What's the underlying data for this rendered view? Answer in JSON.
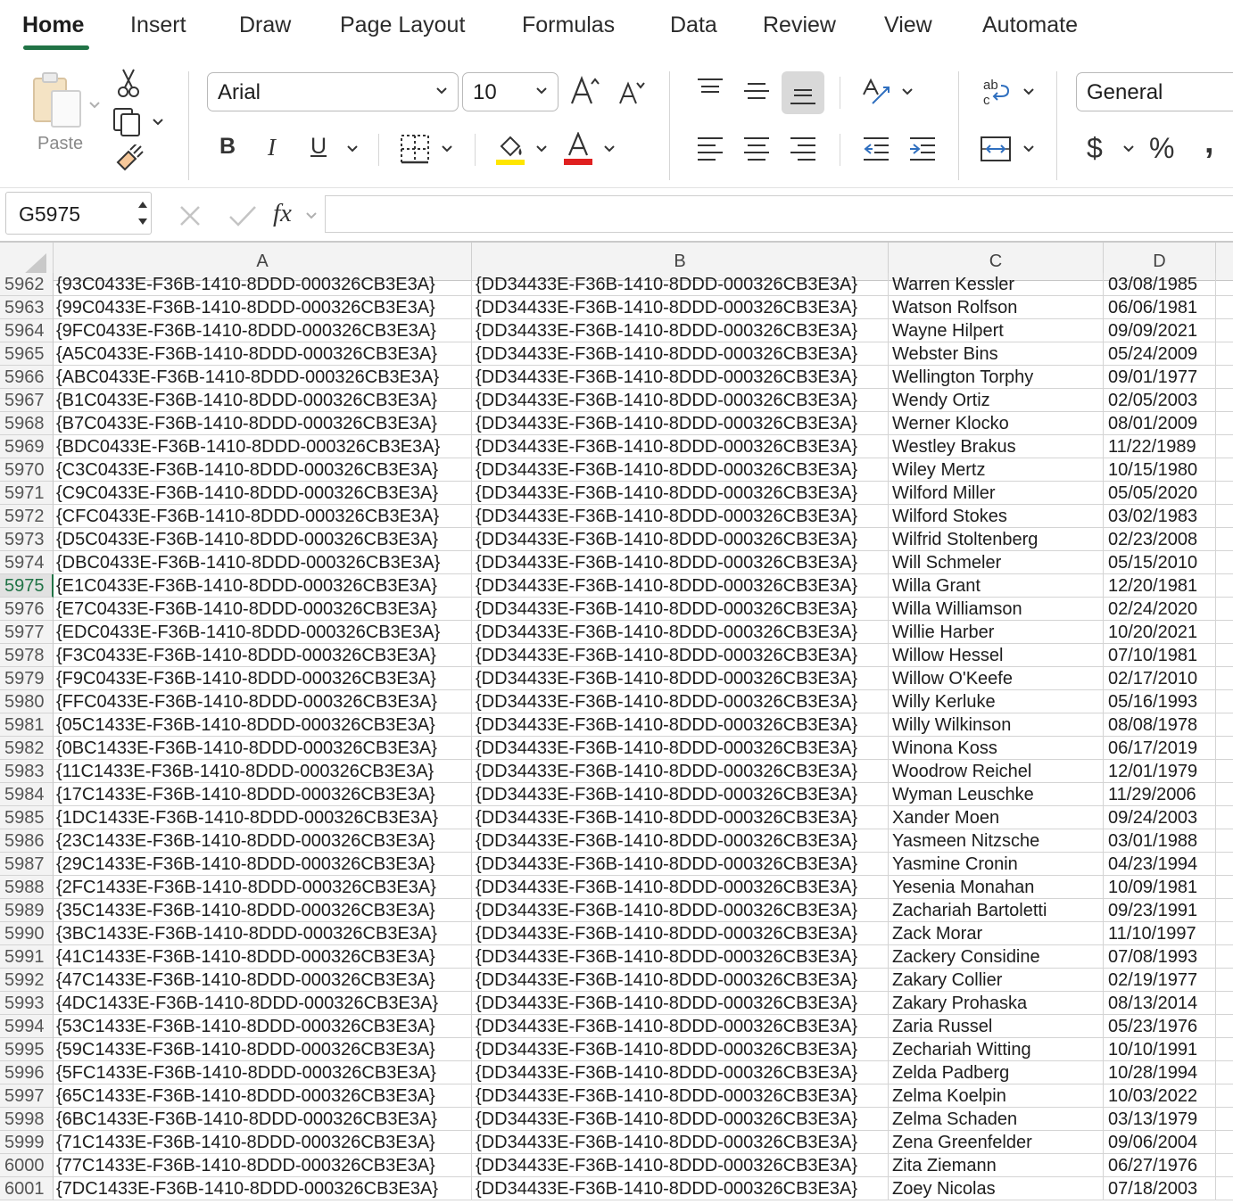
{
  "tabs": [
    "Home",
    "Insert",
    "Draw",
    "Page Layout",
    "Formulas",
    "Data",
    "Review",
    "View",
    "Automate"
  ],
  "clipboard": {
    "paste_label": "Paste"
  },
  "font": {
    "name": "Arial",
    "size": "10",
    "bold": "B",
    "italic": "I",
    "underline": "U"
  },
  "number": {
    "format": "General",
    "currency": "$",
    "percent": "%",
    "comma": "‚"
  },
  "formula_bar": {
    "name_box": "G5975",
    "fx": "fx",
    "value": ""
  },
  "colors": {
    "accent": "#217346",
    "fill": "#ffe600",
    "font_color": "#e02020"
  },
  "columns": [
    "A",
    "B",
    "C",
    "D"
  ],
  "selected_row": "5975",
  "rows": [
    {
      "n": "5962",
      "a": "{93C0433E-F36B-1410-8DDD-000326CB3E3A}",
      "b": "{DD34433E-F36B-1410-8DDD-000326CB3E3A}",
      "c": "Warren Kessler",
      "d": "03/08/1985"
    },
    {
      "n": "5963",
      "a": "{99C0433E-F36B-1410-8DDD-000326CB3E3A}",
      "b": "{DD34433E-F36B-1410-8DDD-000326CB3E3A}",
      "c": "Watson Rolfson",
      "d": "06/06/1981"
    },
    {
      "n": "5964",
      "a": "{9FC0433E-F36B-1410-8DDD-000326CB3E3A}",
      "b": "{DD34433E-F36B-1410-8DDD-000326CB3E3A}",
      "c": "Wayne Hilpert",
      "d": "09/09/2021"
    },
    {
      "n": "5965",
      "a": "{A5C0433E-F36B-1410-8DDD-000326CB3E3A}",
      "b": "{DD34433E-F36B-1410-8DDD-000326CB3E3A}",
      "c": "Webster Bins",
      "d": "05/24/2009"
    },
    {
      "n": "5966",
      "a": "{ABC0433E-F36B-1410-8DDD-000326CB3E3A}",
      "b": "{DD34433E-F36B-1410-8DDD-000326CB3E3A}",
      "c": "Wellington Torphy",
      "d": "09/01/1977"
    },
    {
      "n": "5967",
      "a": "{B1C0433E-F36B-1410-8DDD-000326CB3E3A}",
      "b": "{DD34433E-F36B-1410-8DDD-000326CB3E3A}",
      "c": "Wendy Ortiz",
      "d": "02/05/2003"
    },
    {
      "n": "5968",
      "a": "{B7C0433E-F36B-1410-8DDD-000326CB3E3A}",
      "b": "{DD34433E-F36B-1410-8DDD-000326CB3E3A}",
      "c": "Werner Klocko",
      "d": "08/01/2009"
    },
    {
      "n": "5969",
      "a": "{BDC0433E-F36B-1410-8DDD-000326CB3E3A}",
      "b": "{DD34433E-F36B-1410-8DDD-000326CB3E3A}",
      "c": "Westley Brakus",
      "d": "11/22/1989"
    },
    {
      "n": "5970",
      "a": "{C3C0433E-F36B-1410-8DDD-000326CB3E3A}",
      "b": "{DD34433E-F36B-1410-8DDD-000326CB3E3A}",
      "c": "Wiley Mertz",
      "d": "10/15/1980"
    },
    {
      "n": "5971",
      "a": "{C9C0433E-F36B-1410-8DDD-000326CB3E3A}",
      "b": "{DD34433E-F36B-1410-8DDD-000326CB3E3A}",
      "c": "Wilford Miller",
      "d": "05/05/2020"
    },
    {
      "n": "5972",
      "a": "{CFC0433E-F36B-1410-8DDD-000326CB3E3A}",
      "b": "{DD34433E-F36B-1410-8DDD-000326CB3E3A}",
      "c": "Wilford Stokes",
      "d": "03/02/1983"
    },
    {
      "n": "5973",
      "a": "{D5C0433E-F36B-1410-8DDD-000326CB3E3A}",
      "b": "{DD34433E-F36B-1410-8DDD-000326CB3E3A}",
      "c": "Wilfrid Stoltenberg",
      "d": "02/23/2008"
    },
    {
      "n": "5974",
      "a": "{DBC0433E-F36B-1410-8DDD-000326CB3E3A}",
      "b": "{DD34433E-F36B-1410-8DDD-000326CB3E3A}",
      "c": "Will Schmeler",
      "d": "05/15/2010"
    },
    {
      "n": "5975",
      "a": "{E1C0433E-F36B-1410-8DDD-000326CB3E3A}",
      "b": "{DD34433E-F36B-1410-8DDD-000326CB3E3A}",
      "c": "Willa Grant",
      "d": "12/20/1981"
    },
    {
      "n": "5976",
      "a": "{E7C0433E-F36B-1410-8DDD-000326CB3E3A}",
      "b": "{DD34433E-F36B-1410-8DDD-000326CB3E3A}",
      "c": "Willa Williamson",
      "d": "02/24/2020"
    },
    {
      "n": "5977",
      "a": "{EDC0433E-F36B-1410-8DDD-000326CB3E3A}",
      "b": "{DD34433E-F36B-1410-8DDD-000326CB3E3A}",
      "c": "Willie Harber",
      "d": "10/20/2021"
    },
    {
      "n": "5978",
      "a": "{F3C0433E-F36B-1410-8DDD-000326CB3E3A}",
      "b": "{DD34433E-F36B-1410-8DDD-000326CB3E3A}",
      "c": "Willow Hessel",
      "d": "07/10/1981"
    },
    {
      "n": "5979",
      "a": "{F9C0433E-F36B-1410-8DDD-000326CB3E3A}",
      "b": "{DD34433E-F36B-1410-8DDD-000326CB3E3A}",
      "c": "Willow O'Keefe",
      "d": "02/17/2010"
    },
    {
      "n": "5980",
      "a": "{FFC0433E-F36B-1410-8DDD-000326CB3E3A}",
      "b": "{DD34433E-F36B-1410-8DDD-000326CB3E3A}",
      "c": "Willy Kerluke",
      "d": "05/16/1993"
    },
    {
      "n": "5981",
      "a": "{05C1433E-F36B-1410-8DDD-000326CB3E3A}",
      "b": "{DD34433E-F36B-1410-8DDD-000326CB3E3A}",
      "c": "Willy Wilkinson",
      "d": "08/08/1978"
    },
    {
      "n": "5982",
      "a": "{0BC1433E-F36B-1410-8DDD-000326CB3E3A}",
      "b": "{DD34433E-F36B-1410-8DDD-000326CB3E3A}",
      "c": "Winona Koss",
      "d": "06/17/2019"
    },
    {
      "n": "5983",
      "a": "{11C1433E-F36B-1410-8DDD-000326CB3E3A}",
      "b": "{DD34433E-F36B-1410-8DDD-000326CB3E3A}",
      "c": "Woodrow Reichel",
      "d": "12/01/1979"
    },
    {
      "n": "5984",
      "a": "{17C1433E-F36B-1410-8DDD-000326CB3E3A}",
      "b": "{DD34433E-F36B-1410-8DDD-000326CB3E3A}",
      "c": "Wyman Leuschke",
      "d": "11/29/2006"
    },
    {
      "n": "5985",
      "a": "{1DC1433E-F36B-1410-8DDD-000326CB3E3A}",
      "b": "{DD34433E-F36B-1410-8DDD-000326CB3E3A}",
      "c": "Xander Moen",
      "d": "09/24/2003"
    },
    {
      "n": "5986",
      "a": "{23C1433E-F36B-1410-8DDD-000326CB3E3A}",
      "b": "{DD34433E-F36B-1410-8DDD-000326CB3E3A}",
      "c": "Yasmeen Nitzsche",
      "d": "03/01/1988"
    },
    {
      "n": "5987",
      "a": "{29C1433E-F36B-1410-8DDD-000326CB3E3A}",
      "b": "{DD34433E-F36B-1410-8DDD-000326CB3E3A}",
      "c": "Yasmine Cronin",
      "d": "04/23/1994"
    },
    {
      "n": "5988",
      "a": "{2FC1433E-F36B-1410-8DDD-000326CB3E3A}",
      "b": "{DD34433E-F36B-1410-8DDD-000326CB3E3A}",
      "c": "Yesenia Monahan",
      "d": "10/09/1981"
    },
    {
      "n": "5989",
      "a": "{35C1433E-F36B-1410-8DDD-000326CB3E3A}",
      "b": "{DD34433E-F36B-1410-8DDD-000326CB3E3A}",
      "c": "Zachariah Bartoletti",
      "d": "09/23/1991"
    },
    {
      "n": "5990",
      "a": "{3BC1433E-F36B-1410-8DDD-000326CB3E3A}",
      "b": "{DD34433E-F36B-1410-8DDD-000326CB3E3A}",
      "c": "Zack Morar",
      "d": "11/10/1997"
    },
    {
      "n": "5991",
      "a": "{41C1433E-F36B-1410-8DDD-000326CB3E3A}",
      "b": "{DD34433E-F36B-1410-8DDD-000326CB3E3A}",
      "c": "Zackery Considine",
      "d": "07/08/1993"
    },
    {
      "n": "5992",
      "a": "{47C1433E-F36B-1410-8DDD-000326CB3E3A}",
      "b": "{DD34433E-F36B-1410-8DDD-000326CB3E3A}",
      "c": "Zakary Collier",
      "d": "02/19/1977"
    },
    {
      "n": "5993",
      "a": "{4DC1433E-F36B-1410-8DDD-000326CB3E3A}",
      "b": "{DD34433E-F36B-1410-8DDD-000326CB3E3A}",
      "c": "Zakary Prohaska",
      "d": "08/13/2014"
    },
    {
      "n": "5994",
      "a": "{53C1433E-F36B-1410-8DDD-000326CB3E3A}",
      "b": "{DD34433E-F36B-1410-8DDD-000326CB3E3A}",
      "c": "Zaria Russel",
      "d": "05/23/1976"
    },
    {
      "n": "5995",
      "a": "{59C1433E-F36B-1410-8DDD-000326CB3E3A}",
      "b": "{DD34433E-F36B-1410-8DDD-000326CB3E3A}",
      "c": "Zechariah Witting",
      "d": "10/10/1991"
    },
    {
      "n": "5996",
      "a": "{5FC1433E-F36B-1410-8DDD-000326CB3E3A}",
      "b": "{DD34433E-F36B-1410-8DDD-000326CB3E3A}",
      "c": "Zelda Padberg",
      "d": "10/28/1994"
    },
    {
      "n": "5997",
      "a": "{65C1433E-F36B-1410-8DDD-000326CB3E3A}",
      "b": "{DD34433E-F36B-1410-8DDD-000326CB3E3A}",
      "c": "Zelma Koelpin",
      "d": "10/03/2022"
    },
    {
      "n": "5998",
      "a": "{6BC1433E-F36B-1410-8DDD-000326CB3E3A}",
      "b": "{DD34433E-F36B-1410-8DDD-000326CB3E3A}",
      "c": "Zelma Schaden",
      "d": "03/13/1979"
    },
    {
      "n": "5999",
      "a": "{71C1433E-F36B-1410-8DDD-000326CB3E3A}",
      "b": "{DD34433E-F36B-1410-8DDD-000326CB3E3A}",
      "c": "Zena Greenfelder",
      "d": "09/06/2004"
    },
    {
      "n": "6000",
      "a": "{77C1433E-F36B-1410-8DDD-000326CB3E3A}",
      "b": "{DD34433E-F36B-1410-8DDD-000326CB3E3A}",
      "c": "Zita Ziemann",
      "d": "06/27/1976"
    },
    {
      "n": "6001",
      "a": "{7DC1433E-F36B-1410-8DDD-000326CB3E3A}",
      "b": "{DD34433E-F36B-1410-8DDD-000326CB3E3A}",
      "c": "Zoey Nicolas",
      "d": "07/18/2003"
    }
  ]
}
